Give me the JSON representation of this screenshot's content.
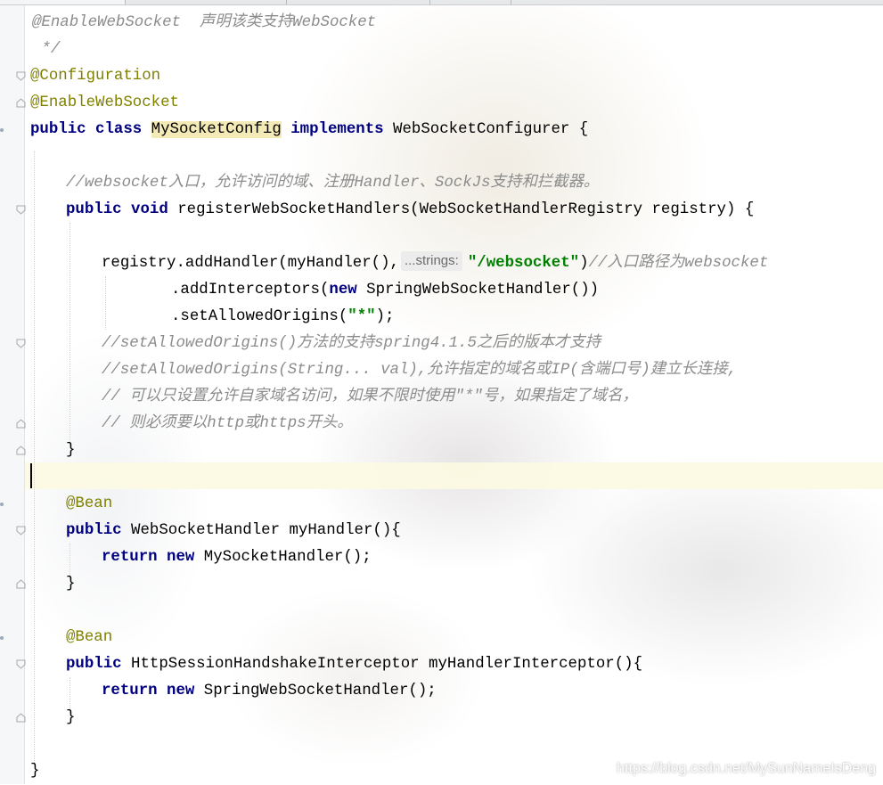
{
  "editor": {
    "language": "java",
    "colors": {
      "keyword": "#000080",
      "annotation": "#808000",
      "comment": "#8c8c8c",
      "string": "#008000",
      "identifier_highlight": "#f4eab6",
      "caret_line": "#fcfae2"
    }
  },
  "code": {
    "l1": "@EnableWebSocket  声明该类支持WebSocket",
    "l2": " */",
    "l3": "@Configuration",
    "l4": "@EnableWebSocket",
    "l5_kw": "public class ",
    "l5_class": "MySocketConfig",
    "l5_impl": "implements",
    "l5_rest": " WebSocketConfigurer {",
    "l7": "//websocket入口，允许访问的域、注册Handler、SockJs支持和拦截器。",
    "l8_kw": "public void ",
    "l8_rest": "registerWebSocketHandlers(WebSocketHandlerRegistry registry) {",
    "l10_a": "registry.addHandler(myHandler(),",
    "l10_hint": "...strings:",
    "l10_str": "\"/websocket\"",
    "l10_b": ")",
    "l10_cmt": "//入口路径为websocket",
    "l11_a": ".addInterceptors(",
    "l11_kw": "new",
    "l11_b": " SpringWebSocketHandler())",
    "l12_a": ".setAllowedOrigins(",
    "l12_str": "\"*\"",
    "l12_b": ");",
    "l13": "//setAllowedOrigins()方法的支持spring4.1.5之后的版本才支持",
    "l14": "//setAllowedOrigins(String... val),允许指定的域名或IP(含端口号)建立长连接,",
    "l15": "// 可以只设置允许自家域名访问，如果不限时使用\"*\"号，如果指定了域名，",
    "l16": "// 则必须要以http或https开头。",
    "l17": "}",
    "l19": "@Bean",
    "l20_kw": "public",
    "l20_rest": " WebSocketHandler myHandler(){",
    "l21_kw": "return new",
    "l21_rest": " MySocketHandler();",
    "l22": "}",
    "l24": "@Bean",
    "l25_kw": "public",
    "l25_rest": " HttpSessionHandshakeInterceptor myHandlerInterceptor(){",
    "l26_kw": "return new",
    "l26_rest": " SpringWebSocketHandler();",
    "l27": "}",
    "l29": "}"
  },
  "watermark": "https://blog.csdn.net/MySunNameIsDeng"
}
